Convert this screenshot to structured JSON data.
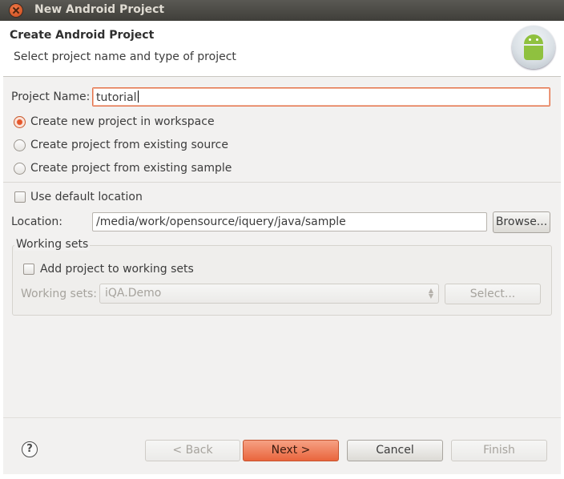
{
  "window": {
    "title": "New Android Project"
  },
  "banner": {
    "heading": "Create Android Project",
    "subheading": "Select project name and type of project",
    "logo_icon": "android-logo-icon"
  },
  "form": {
    "project_name_label": "Project Name:",
    "project_name_value": "tutorial",
    "radio_options": [
      {
        "label": "Create new project in workspace",
        "selected": true
      },
      {
        "label": "Create project from existing source",
        "selected": false
      },
      {
        "label": "Create project from existing sample",
        "selected": false
      }
    ],
    "use_default_location_label": "Use default location",
    "use_default_location_checked": false,
    "location_label": "Location:",
    "location_value": "/media/work/opensource/iquery/java/sample",
    "browse_label": "Browse...",
    "working_sets": {
      "group_title": "Working sets",
      "add_to_sets_label": "Add project to working sets",
      "add_to_sets_checked": false,
      "sets_label": "Working sets:",
      "sets_value": "iQA.Demo",
      "select_label": "Select..."
    }
  },
  "footer": {
    "help_icon": "help-icon",
    "back_label": "< Back",
    "next_label": "Next >",
    "cancel_label": "Cancel",
    "finish_label": "Finish"
  },
  "colors": {
    "accent": "#e9653d",
    "titlebar": "#3f3e3a",
    "content_bg": "#f2f1f0"
  }
}
